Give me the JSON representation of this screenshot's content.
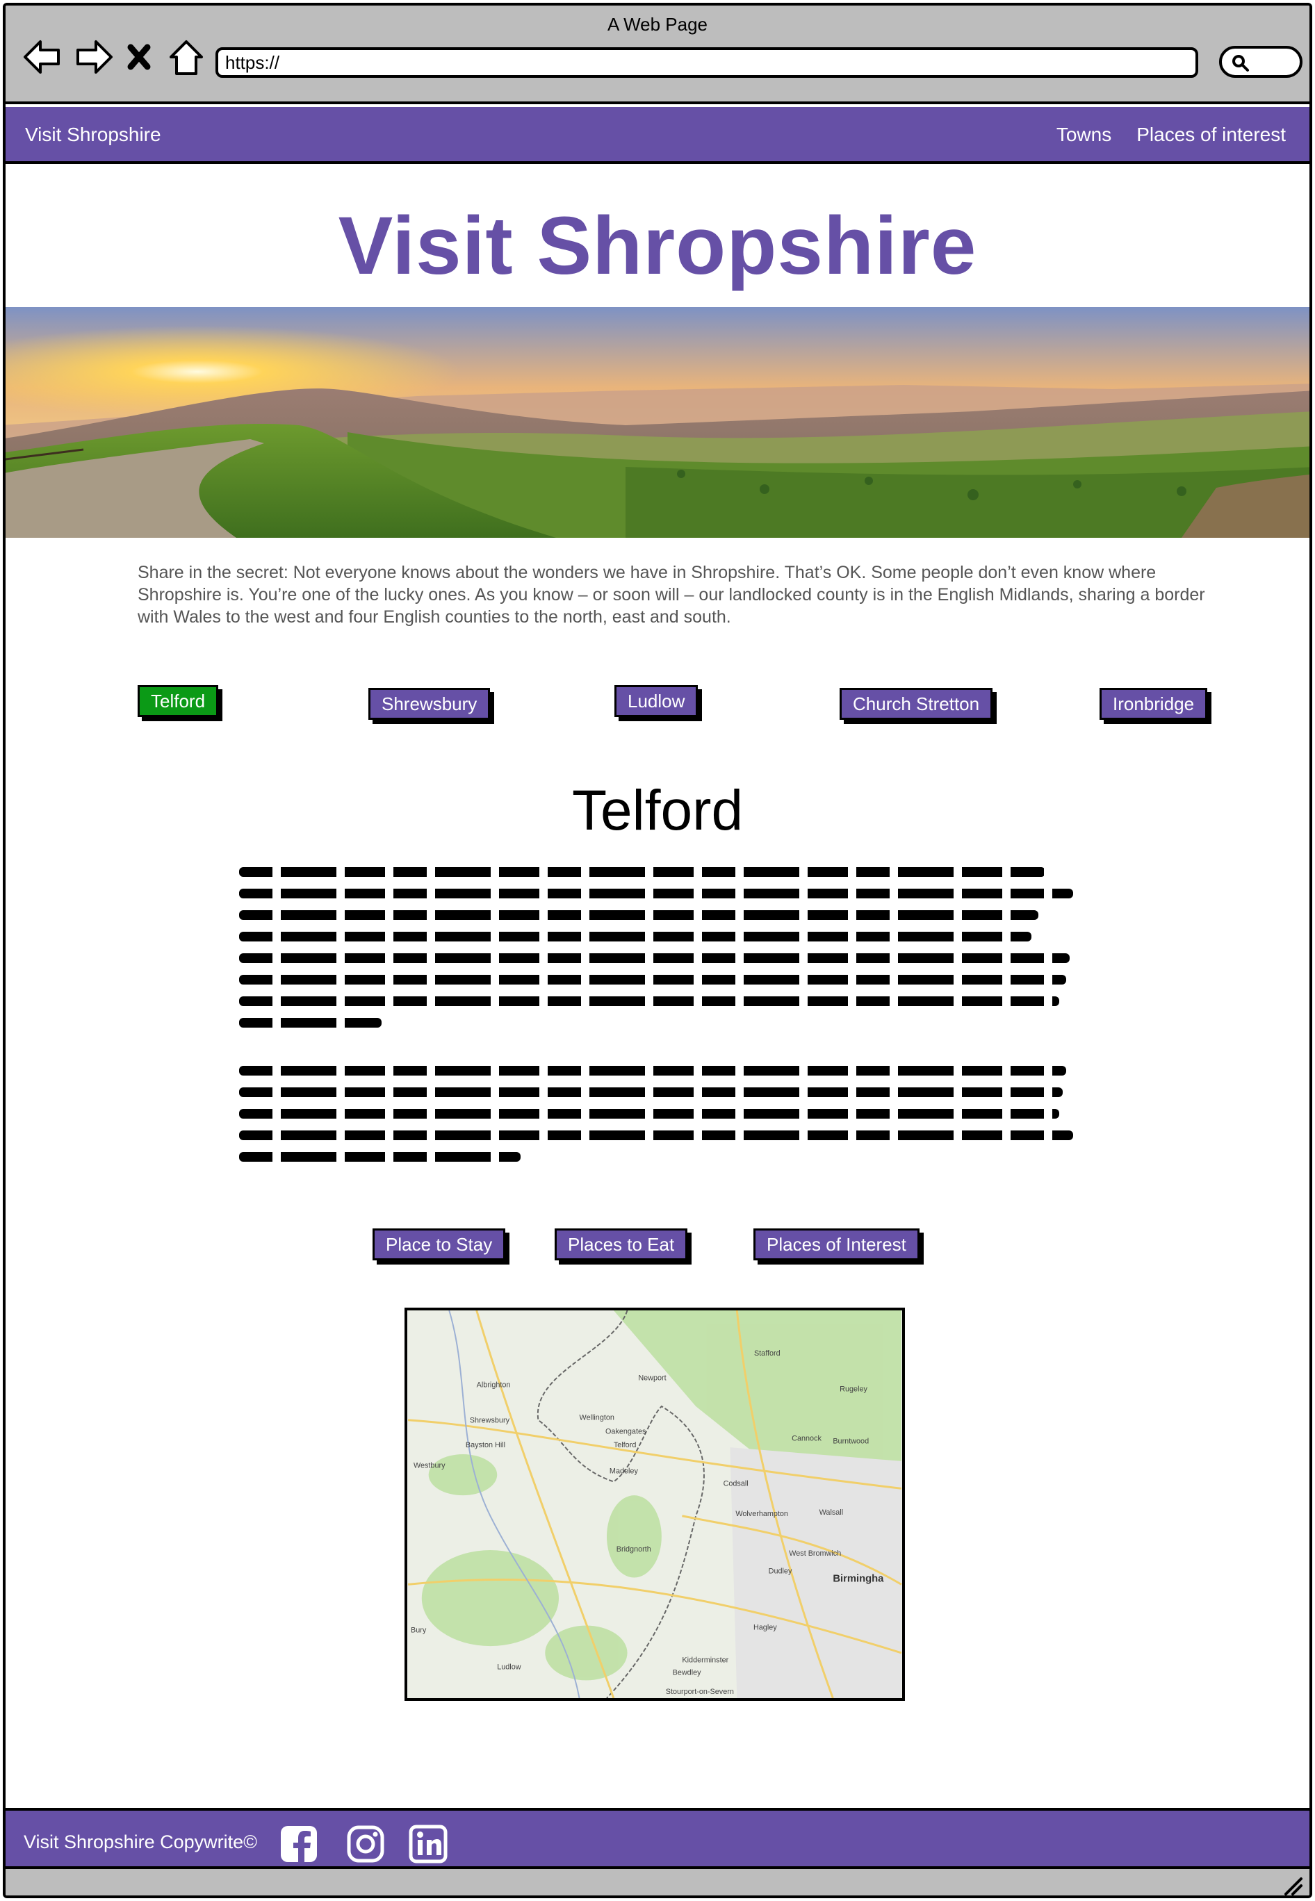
{
  "browser": {
    "window_title": "A Web Page",
    "url": "https://"
  },
  "navbar": {
    "brand": "Visit Shropshire",
    "links": [
      "Towns",
      "Places of interest"
    ]
  },
  "hero": {
    "title": "Visit Shropshire"
  },
  "intro": {
    "text": "Share in the secret: Not everyone knows about the wonders we have in Shropshire. That’s OK. Some people don’t even know where Shropshire is. You’re one of the lucky ones. As you know – or soon will – our landlocked county is in the English Midlands, sharing a border with Wales to the west and four English counties to the north, east and south."
  },
  "towns": {
    "buttons": [
      "Telford",
      "Shrewsbury",
      "Ludlow",
      "Church Stretton",
      "Ironbridge"
    ],
    "selected": "Telford"
  },
  "town_section": {
    "title": "Telford",
    "categories": [
      "Place to Stay",
      "Places to Eat",
      "Places of Interest"
    ]
  },
  "map": {
    "labels": [
      "Stafford",
      "Newport",
      "Rugeley",
      "Albrighton",
      "Wellington",
      "Oakengates",
      "Telford",
      "Shrewsbury",
      "Bayston Hill",
      "Westbury",
      "Madeley",
      "Cannock",
      "Burntwood",
      "Codsall",
      "Wolverhampton",
      "Walsall",
      "West Bromwich",
      "Dudley",
      "Birmingha",
      "Bridgnorth",
      "Hagley",
      "Kidderminster",
      "Bewdley",
      "Stourport-on-Severn",
      "Ludlow",
      "Bury"
    ]
  },
  "footer": {
    "text": "Visit Shropshire Copywrite©",
    "social": [
      "facebook-icon",
      "instagram-icon",
      "linkedin-icon"
    ]
  },
  "colors": {
    "brand_purple": "#6650a6",
    "active_green": "#0b9a16",
    "chrome_gray": "#bdbdbd"
  }
}
